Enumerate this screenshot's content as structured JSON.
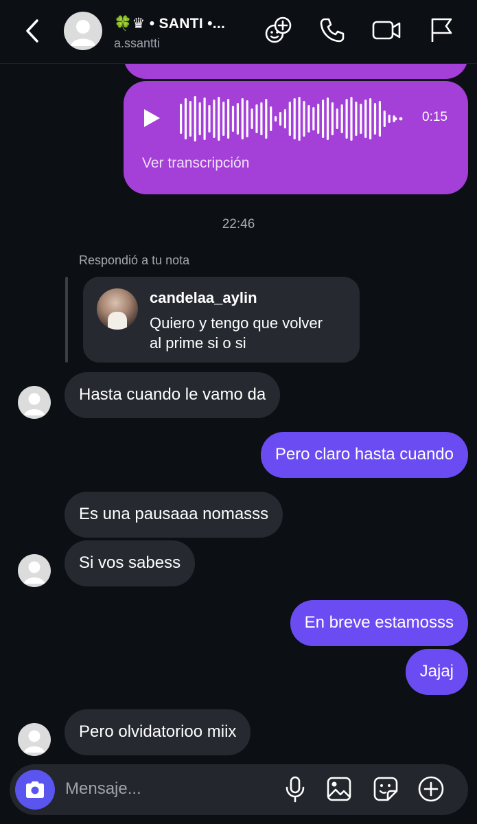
{
  "header": {
    "name": "🍀♛ • SANTI •...",
    "username": "a.ssantti"
  },
  "voice_message": {
    "duration": "0:15",
    "transcript_link": "Ver transcripción"
  },
  "timestamp": "22:46",
  "reply": {
    "caption": "Respondió a tu nota",
    "note_user": "candelaa_aylin",
    "note_text_line1": "Quiero y tengo que volver",
    "note_text_line2": "al prime si o si"
  },
  "messages": [
    {
      "side": "in",
      "text": "Hasta cuando le vamo da"
    },
    {
      "side": "out",
      "text": "Pero claro hasta cuando"
    },
    {
      "side": "in",
      "text": "Es una pausaaa nomasss"
    },
    {
      "side": "in",
      "text": "Si vos sabess"
    },
    {
      "side": "out",
      "text": "En breve estamosss"
    },
    {
      "side": "out",
      "text": "Jajaj"
    },
    {
      "side": "in",
      "text": "Pero olvidatorioo miix"
    }
  ],
  "composer": {
    "placeholder": "Mensaje..."
  },
  "icons": {
    "header": [
      "back-icon",
      "effects-icon",
      "phone-icon",
      "video-icon",
      "flag-icon"
    ],
    "voice": [
      "play-icon"
    ],
    "composer": [
      "camera-icon",
      "microphone-icon",
      "gallery-icon",
      "sticker-icon",
      "plus-icon"
    ]
  },
  "colors": {
    "background": "#0c0f14",
    "incoming_bubble": "#262a30",
    "outgoing_bubble": "#6b4cf2",
    "voice_bubble": "#a43fd8",
    "camera_button": "#5b55f0"
  }
}
